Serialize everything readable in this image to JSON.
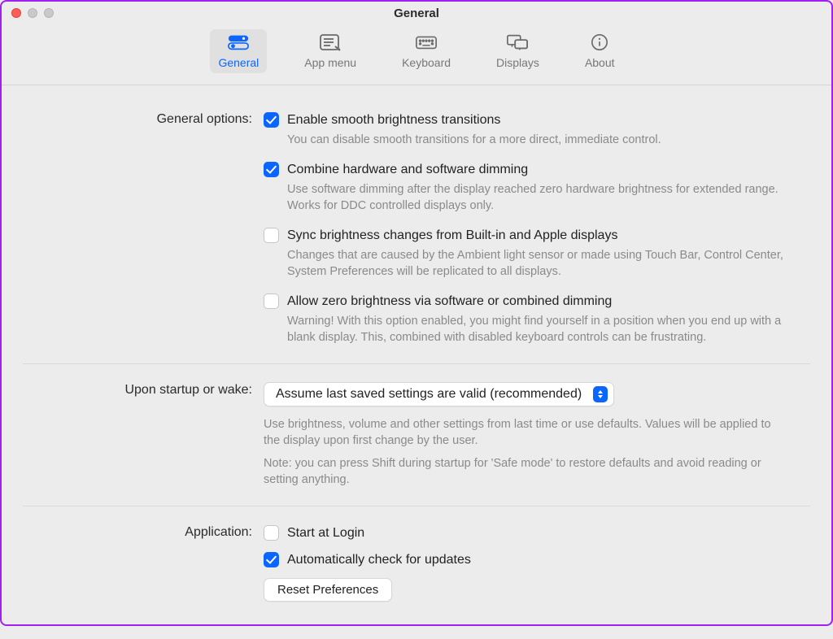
{
  "window": {
    "title": "General"
  },
  "tabs": {
    "general": "General",
    "appmenu": "App menu",
    "keyboard": "Keyboard",
    "displays": "Displays",
    "about": "About"
  },
  "sections": {
    "general_options": {
      "label": "General options:",
      "opt1": {
        "label": "Enable smooth brightness transitions",
        "desc": "You can disable smooth transitions for a more direct, immediate control.",
        "checked": true
      },
      "opt2": {
        "label": "Combine hardware and software dimming",
        "desc": "Use software dimming after the display reached zero hardware brightness for extended range. Works for DDC controlled displays only.",
        "checked": true
      },
      "opt3": {
        "label": "Sync brightness changes from Built-in and Apple displays",
        "desc": "Changes that are caused by the Ambient light sensor or made using Touch Bar, Control Center, System Preferences will be replicated to all displays.",
        "checked": false
      },
      "opt4": {
        "label": "Allow zero brightness via software or combined dimming",
        "desc": "Warning! With this option enabled, you might find yourself in a position when you end up with a blank display. This, combined with disabled keyboard controls can be frustrating.",
        "checked": false
      }
    },
    "startup": {
      "label": "Upon startup or wake:",
      "select_value": "Assume last saved settings are valid (recommended)",
      "desc1": "Use brightness, volume and other settings from last time or use defaults. Values will be applied to the display upon first change by the user.",
      "desc2": "Note: you can press Shift during startup for 'Safe mode' to restore defaults and avoid reading or setting anything."
    },
    "application": {
      "label": "Application:",
      "opt1": {
        "label": "Start at Login",
        "checked": false
      },
      "opt2": {
        "label": "Automatically check for updates",
        "checked": true
      },
      "reset_btn": "Reset Preferences"
    }
  }
}
